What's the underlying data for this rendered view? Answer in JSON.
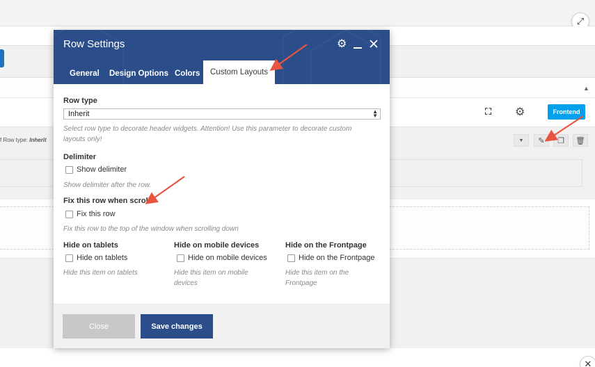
{
  "modal": {
    "title": "Row Settings",
    "tabs": [
      {
        "label": "General"
      },
      {
        "label": "Design Options"
      },
      {
        "label": "Colors"
      },
      {
        "label": "Custom Layouts"
      }
    ],
    "active_tab": "Custom Layouts",
    "fields": {
      "row_type": {
        "label": "Row type",
        "value": "Inherit",
        "help": "Select row type to decorate header widgets. Attention! Use this parameter to decorate custom layouts only!"
      },
      "delimiter": {
        "label": "Delimiter",
        "checkbox_label": "Show delimiter",
        "checked": false,
        "help": "Show delimiter after the row."
      },
      "fix_row": {
        "label": "Fix this row when scroll",
        "checkbox_label": "Fix this row",
        "checked": false,
        "help": "Fix this row to the top of the window when scrolling down"
      },
      "hide_tablets": {
        "label": "Hide on tablets",
        "checkbox_label": "Hide on tablets",
        "checked": false,
        "help": "Hide this item on tablets"
      },
      "hide_mobile": {
        "label": "Hide on mobile devices",
        "checkbox_label": "Hide on mobile devices",
        "checked": false,
        "help": "Hide this item on mobile devices"
      },
      "hide_frontpage": {
        "label": "Hide on the Frontpage",
        "checkbox_label": "Hide on the Frontpage",
        "checked": false,
        "help": "Hide this item on the Frontpage"
      }
    },
    "footer": {
      "close_label": "Close",
      "save_label": "Save changes"
    },
    "header_icons": [
      "gear-icon",
      "minimize-icon",
      "close-icon"
    ]
  },
  "background": {
    "frontend_label": "Frontend",
    "row_type_prefix": "f Row type:",
    "row_type_value": "Inherit",
    "icons": [
      "fullscreen-icon",
      "gear-icon",
      "caret-down-icon",
      "pencil-icon",
      "copy-icon",
      "trash-icon",
      "expand-icon",
      "close-icon"
    ]
  },
  "colors": {
    "modal_header": "#2b4e8a",
    "save_button": "#2b4e8a",
    "close_button": "#c8c8c8",
    "frontend_button": "#00a0ec",
    "annotation_arrows": "#e8553f"
  }
}
